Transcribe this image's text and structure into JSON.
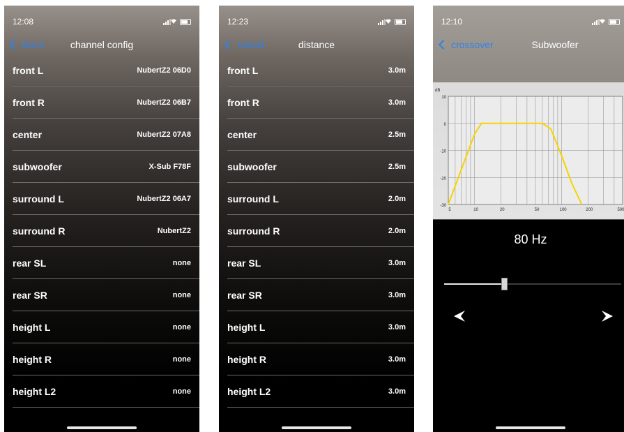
{
  "screens": [
    {
      "time": "12:08",
      "back_label": "Back",
      "title": "channel config",
      "rows": [
        {
          "label": "front L",
          "value": "NubertZ2 06D0"
        },
        {
          "label": "front R",
          "value": "NubertZ2 06B7"
        },
        {
          "label": "center",
          "value": "NubertZ2 07A8"
        },
        {
          "label": "subwoofer",
          "value": "X-Sub F78F"
        },
        {
          "label": "surround L",
          "value": "NubertZ2 06A7"
        },
        {
          "label": "surround R",
          "value": "NubertZ2"
        },
        {
          "label": "rear SL",
          "value": "none"
        },
        {
          "label": "rear SR",
          "value": "none"
        },
        {
          "label": "height L",
          "value": "none"
        },
        {
          "label": "height R",
          "value": "none"
        },
        {
          "label": "height L2",
          "value": "none"
        }
      ]
    },
    {
      "time": "12:23",
      "back_label": "sound",
      "title": "distance",
      "rows": [
        {
          "label": "front L",
          "value": "3.0m"
        },
        {
          "label": "front R",
          "value": "3.0m"
        },
        {
          "label": "center",
          "value": "2.5m"
        },
        {
          "label": "subwoofer",
          "value": "2.5m"
        },
        {
          "label": "surround L",
          "value": "2.0m"
        },
        {
          "label": "surround R",
          "value": "2.0m"
        },
        {
          "label": "rear SL",
          "value": "3.0m"
        },
        {
          "label": "rear SR",
          "value": "3.0m"
        },
        {
          "label": "height L",
          "value": "3.0m"
        },
        {
          "label": "height R",
          "value": "3.0m"
        },
        {
          "label": "height L2",
          "value": "3.0m"
        }
      ]
    },
    {
      "time": "12:10",
      "back_label": "crossover",
      "title": "Subwoofer",
      "frequency_readout": "80 Hz",
      "slider_fraction": 0.34
    }
  ],
  "chart_data": {
    "type": "line",
    "ylabel": "dB",
    "yticks": [
      "10",
      "0",
      "-10",
      "-20",
      "-30"
    ],
    "ylim": [
      -30,
      10
    ],
    "xticks": [
      "5",
      "10",
      "20",
      "50",
      "100",
      "200",
      "500 Hz"
    ],
    "x_scale": "log",
    "xlim": [
      5,
      500
    ],
    "grid": true,
    "series": [
      {
        "x": [
          5,
          10,
          12,
          20,
          60,
          75,
          100,
          130,
          170
        ],
        "y": [
          -30,
          -4,
          0,
          0,
          0,
          -2,
          -12,
          -22,
          -30
        ],
        "color": "#f5d300"
      }
    ]
  }
}
